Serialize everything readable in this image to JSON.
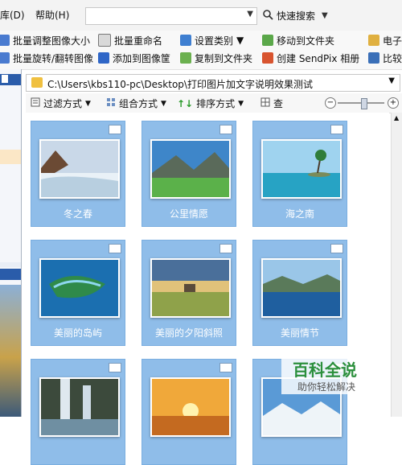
{
  "menubar": {
    "items": [
      "库(D)",
      "帮助(H)"
    ],
    "quick_search": "快速搜索"
  },
  "toolbar": {
    "row1": [
      "批量调整图像大小",
      "批量重命名",
      "设置类别",
      "移动到文件夹",
      "电子"
    ],
    "row2": [
      "批量旋转/翻转图像",
      "添加到图像筐",
      "复制到文件夹",
      "创建 SendPix 相册",
      "比较"
    ]
  },
  "path": {
    "value": "C:\\Users\\kbs110-pc\\Desktop\\打印图片加文字说明效果测试"
  },
  "viewbar": {
    "filter": "过滤方式",
    "group": "组合方式",
    "sort": "排序方式",
    "view": "查"
  },
  "zoom": {
    "level": 0.55
  },
  "gallery": {
    "items": [
      {
        "caption": "冬之春"
      },
      {
        "caption": "公里情愿"
      },
      {
        "caption": "海之南"
      },
      {
        "caption": "美丽的岛屿"
      },
      {
        "caption": "美丽的夕阳斜照"
      },
      {
        "caption": "美丽情节"
      },
      {
        "caption": ""
      },
      {
        "caption": ""
      },
      {
        "caption": ""
      }
    ]
  },
  "watermark": {
    "title": "百科全说",
    "subtitle": "助你轻松解决"
  },
  "colors": {
    "tile_bg": "#8fbde9",
    "panel_band": "#2a5caa",
    "watermark_green": "#2b8f3c"
  }
}
